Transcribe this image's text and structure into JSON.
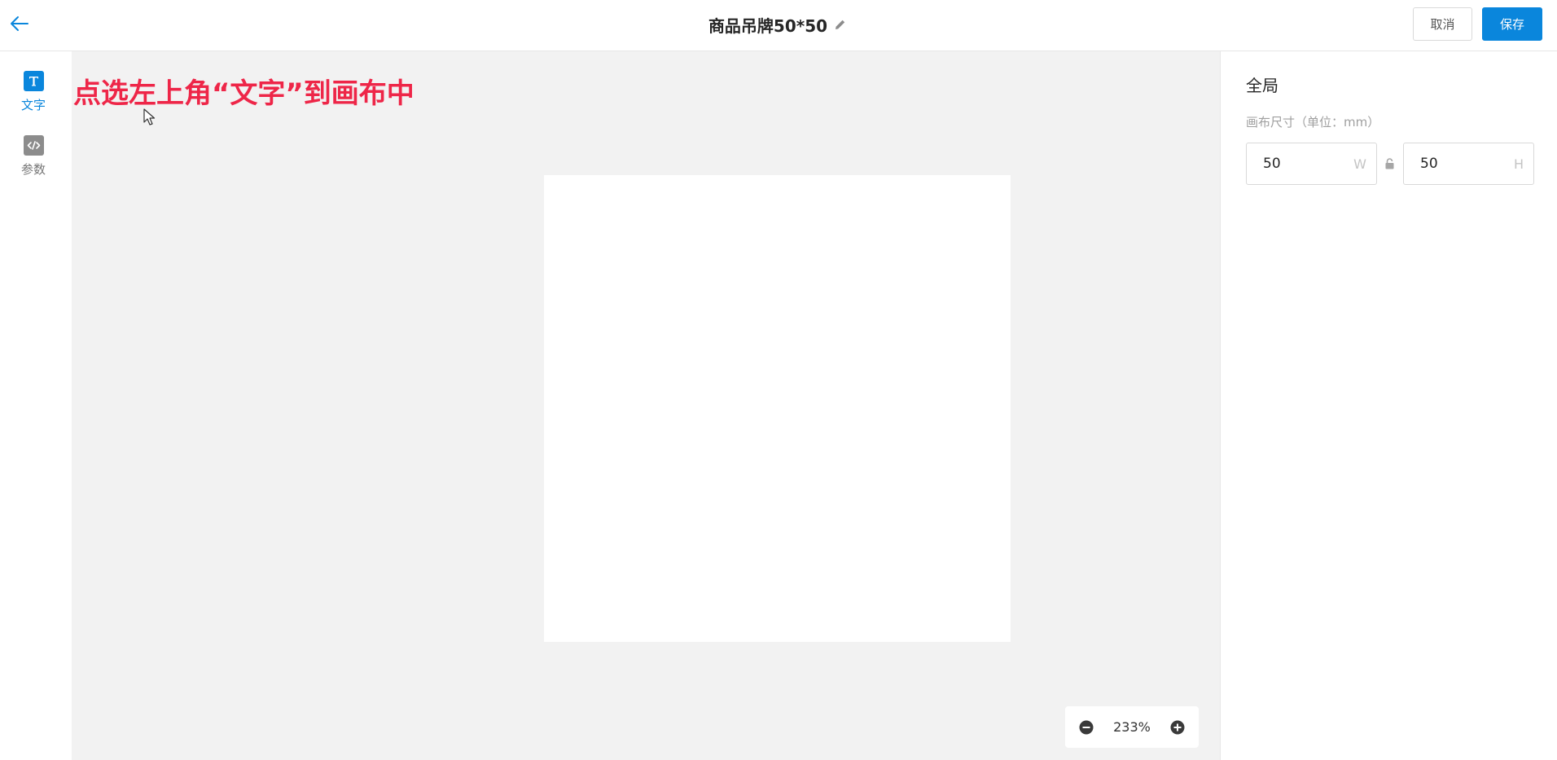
{
  "header": {
    "back_icon": "arrow-left-icon",
    "title": "商品吊牌50*50",
    "edit_icon": "pencil-icon",
    "cancel_label": "取消",
    "save_label": "保存",
    "accent_color": "#0a86dc"
  },
  "tools": [
    {
      "label": "文字",
      "icon": "text-tool-icon",
      "active": true
    },
    {
      "label": "参数",
      "icon": "code-tool-icon",
      "active": false
    }
  ],
  "canvas": {
    "instruction": "点选左上角“文字”到画布中",
    "instruction_color": "#ee2648",
    "zoom": {
      "value": "233%",
      "zoom_out_icon": "minus-circle-icon",
      "zoom_in_icon": "plus-circle-icon"
    }
  },
  "panel": {
    "title": "全局",
    "size_label": "画布尺寸（单位：mm）",
    "width_value": "50",
    "width_unit": "W",
    "height_value": "50",
    "height_unit": "H",
    "lock_icon": "lock-icon"
  }
}
